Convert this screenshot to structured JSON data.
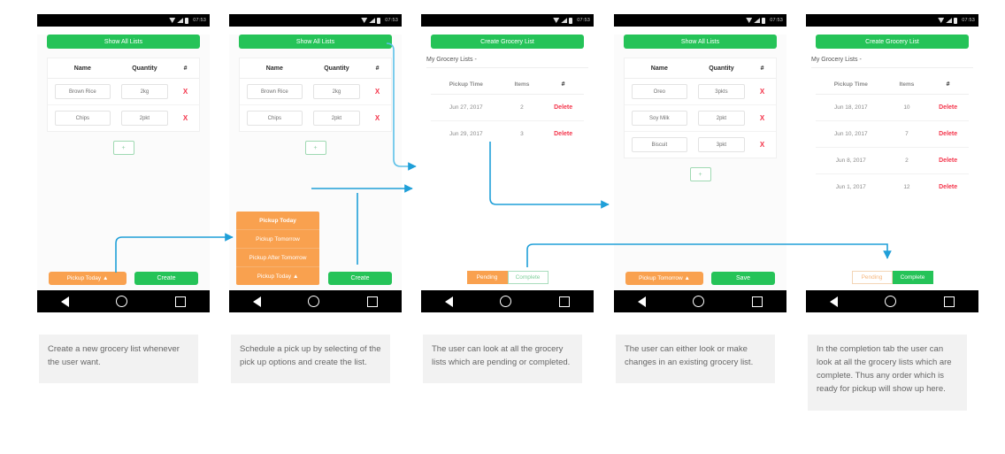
{
  "meta": {
    "status_time": "07:53",
    "accent_green": "#25c358",
    "accent_orange": "#f9a14f",
    "danger_red": "#f4364c",
    "arrow_color": "#1f9fd8"
  },
  "screens": [
    {
      "id": "screen-1-create-list",
      "top_button": "Show All Lists",
      "table": {
        "headers": [
          "Name",
          "Quantity",
          "#"
        ],
        "rows": [
          {
            "name": "Brown Rice",
            "qty": "2kg",
            "action": "X"
          },
          {
            "name": "Chips",
            "qty": "2pkt",
            "action": "X"
          }
        ]
      },
      "add_button": "+",
      "pickup_button": "Pickup Today ▲",
      "primary_button": "Create"
    },
    {
      "id": "screen-2-pickup-dropdown",
      "top_button": "Show All Lists",
      "table": {
        "headers": [
          "Name",
          "Quantity",
          "#"
        ],
        "rows": [
          {
            "name": "Brown Rice",
            "qty": "2kg",
            "action": "X"
          },
          {
            "name": "Chips",
            "qty": "2pkt",
            "action": "X"
          }
        ]
      },
      "add_button": "+",
      "dropdown_options": [
        "Pickup Today",
        "Pickup Tomorrow",
        "Pickup After Tomorrow",
        "Pickup Today ▲"
      ],
      "primary_button": "Create"
    },
    {
      "id": "screen-3-pending-lists",
      "top_button": "Create Grocery List",
      "section_title": "My Grocery Lists -",
      "table": {
        "headers": [
          "Pickup Time",
          "Items",
          "#"
        ],
        "rows": [
          {
            "pickup_time": "Jun 27, 2017",
            "items": "2",
            "action": "Delete"
          },
          {
            "pickup_time": "Jun 29, 2017",
            "items": "3",
            "action": "Delete"
          }
        ]
      },
      "tabs": [
        {
          "label": "Pending",
          "active": true
        },
        {
          "label": "Complete",
          "active": false
        }
      ]
    },
    {
      "id": "screen-4-edit-list",
      "top_button": "Show All Lists",
      "table": {
        "headers": [
          "Name",
          "Quantity",
          "#"
        ],
        "rows": [
          {
            "name": "Oreo",
            "qty": "3pkts",
            "action": "X"
          },
          {
            "name": "Soy Milk",
            "qty": "2pkt",
            "action": "X"
          },
          {
            "name": "Biscuit",
            "qty": "3pkt",
            "action": "X"
          }
        ]
      },
      "add_button": "+",
      "pickup_button": "Pickup Tomorrow ▲",
      "primary_button": "Save"
    },
    {
      "id": "screen-5-complete-lists",
      "top_button": "Create Grocery List",
      "section_title": "My Grocery Lists -",
      "table": {
        "headers": [
          "Pickup Time",
          "Items",
          "#"
        ],
        "rows": [
          {
            "pickup_time": "Jun 18, 2017",
            "items": "10",
            "action": "Delete"
          },
          {
            "pickup_time": "Jun 10, 2017",
            "items": "7",
            "action": "Delete"
          },
          {
            "pickup_time": "Jun 8, 2017",
            "items": "2",
            "action": "Delete"
          },
          {
            "pickup_time": "Jun 1, 2017",
            "items": "12",
            "action": "Delete"
          }
        ]
      },
      "tabs": [
        {
          "label": "Pending",
          "active": false
        },
        {
          "label": "Complete",
          "active": true
        }
      ]
    }
  ],
  "captions": [
    "Create a new grocery list whenever the user want.",
    "Schedule a pick up by selecting of the pick up options and create the list.",
    "The user can look at all the grocery lists which are pending or completed.",
    "The user can either look or make changes in an existing grocery list.",
    "In the completion tab the user can look at all the grocery lists which are complete. Thus any order which is ready for pickup will show up here."
  ]
}
